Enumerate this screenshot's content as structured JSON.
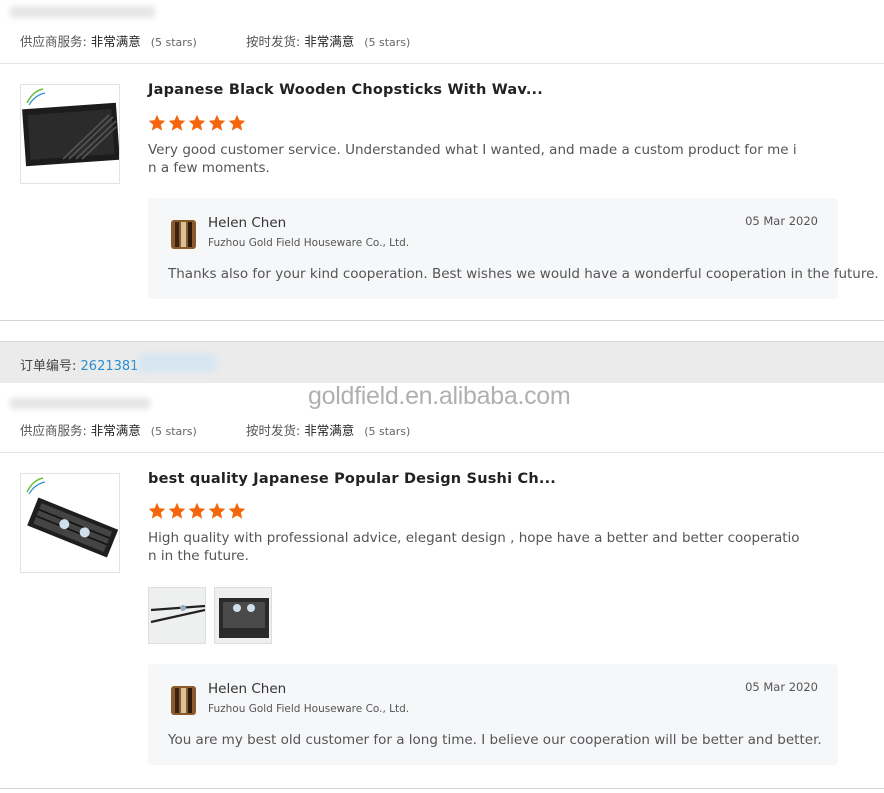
{
  "colors": {
    "star": "#f5650b",
    "order_number": "#2b8ed0",
    "reply_bg": "#f6f7f9"
  },
  "orders": [
    {
      "ratings": {
        "supplier_service_label": "供应商服务:",
        "supplier_service_value": "非常满意",
        "supplier_service_stars": "(5 stars)",
        "ontime_label": "按时发货:",
        "ontime_value": "非常满意",
        "ontime_stars": "(5 stars)"
      },
      "review": {
        "product_title": "Japanese Black Wooden Chopsticks With Wav...",
        "star_rating": 5,
        "text": "Very good customer service. Understanded what I wanted, and made a custom product for me in a few moments.",
        "reply": {
          "name": "Helen Chen",
          "company": "Fuzhou Gold Field Houseware Co., Ltd.",
          "date": "05 Mar 2020",
          "text": "Thanks also for your kind cooperation. Best wishes we would have a wonderful cooperation in the future."
        }
      }
    },
    {
      "order_label": "订单编号:",
      "order_number": "2621381",
      "ratings": {
        "supplier_service_label": "供应商服务:",
        "supplier_service_value": "非常满意",
        "supplier_service_stars": "(5 stars)",
        "ontime_label": "按时发货:",
        "ontime_value": "非常满意",
        "ontime_stars": "(5 stars)"
      },
      "review": {
        "product_title": "best quality Japanese Popular Design Sushi Ch...",
        "star_rating": 5,
        "text": "High quality with professional advice, elegant design , hope have a better and better cooperation in the future.",
        "photos": 2,
        "reply": {
          "name": "Helen Chen",
          "company": "Fuzhou Gold Field Houseware Co., Ltd.",
          "date": "05 Mar 2020",
          "text": "You are my best old customer for a long time.  I believe our cooperation will be better and better."
        }
      }
    }
  ],
  "watermark": "goldfield.en.alibaba.com"
}
